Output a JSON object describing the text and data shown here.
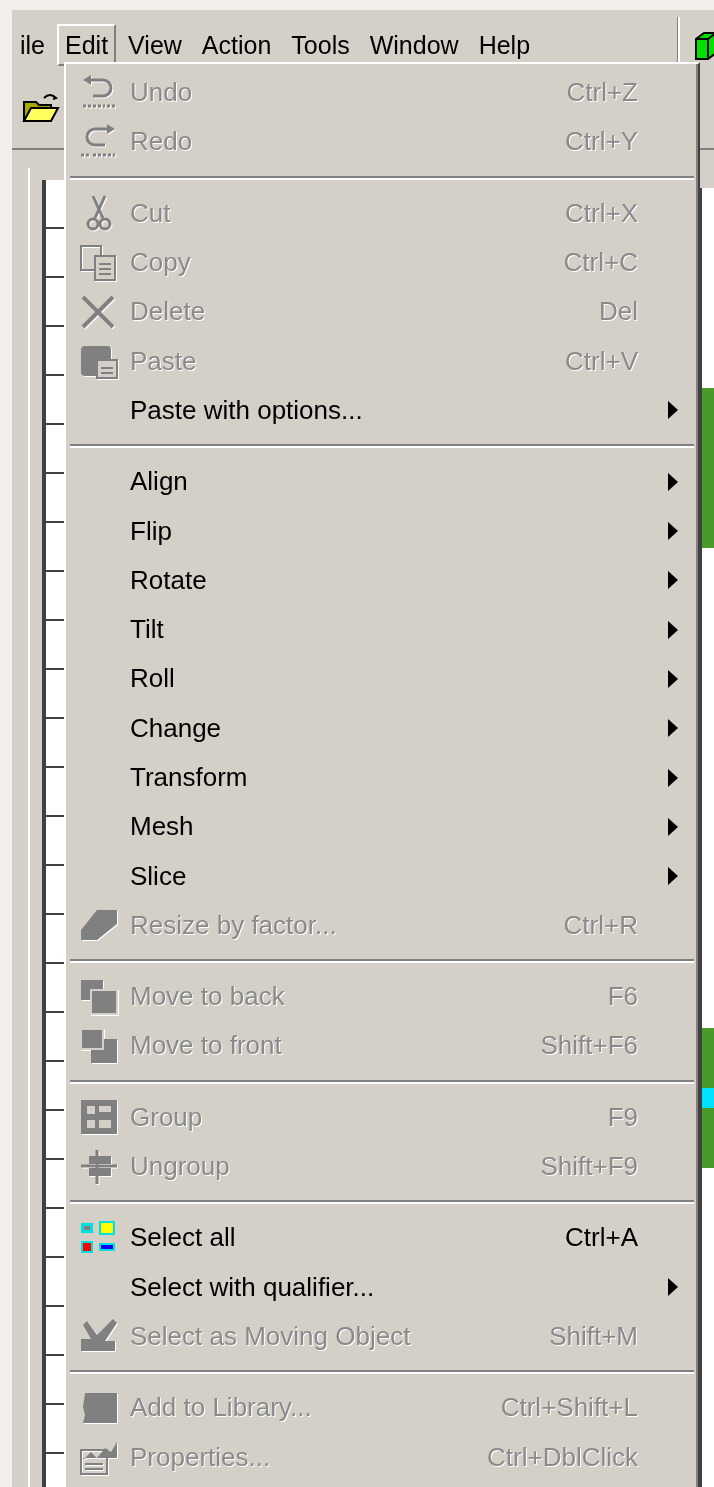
{
  "menu_bar": {
    "items": [
      {
        "label": "ile",
        "selected": false
      },
      {
        "label": "Edit",
        "selected": true
      },
      {
        "label": "View",
        "selected": false
      },
      {
        "label": "Action",
        "selected": false
      },
      {
        "label": "Tools",
        "selected": false
      },
      {
        "label": "Window",
        "selected": false
      },
      {
        "label": "Help",
        "selected": false
      }
    ]
  },
  "menu": {
    "groups": [
      {
        "items": [
          {
            "kind": "undo",
            "label": "Undo",
            "shortcut": "Ctrl+Z",
            "disabled": true,
            "submenu": false
          },
          {
            "kind": "redo",
            "label": "Redo",
            "shortcut": "Ctrl+Y",
            "disabled": true,
            "submenu": false
          }
        ]
      },
      {
        "items": [
          {
            "kind": "cut",
            "label": "Cut",
            "shortcut": "Ctrl+X",
            "disabled": true,
            "submenu": false
          },
          {
            "kind": "copy",
            "label": "Copy",
            "shortcut": "Ctrl+C",
            "disabled": true,
            "submenu": false
          },
          {
            "kind": "delete",
            "label": "Delete",
            "shortcut": "Del",
            "disabled": true,
            "submenu": false
          },
          {
            "kind": "paste",
            "label": "Paste",
            "shortcut": "Ctrl+V",
            "disabled": true,
            "submenu": false
          },
          {
            "kind": "plain",
            "label": "Paste with options...",
            "disabled": false,
            "submenu": true
          }
        ]
      },
      {
        "items": [
          {
            "kind": "plain",
            "label": "Align",
            "disabled": false,
            "submenu": true
          },
          {
            "kind": "plain",
            "label": "Flip",
            "disabled": false,
            "submenu": true
          },
          {
            "kind": "plain",
            "label": "Rotate",
            "disabled": false,
            "submenu": true
          },
          {
            "kind": "plain",
            "label": "Tilt",
            "disabled": false,
            "submenu": true
          },
          {
            "kind": "plain",
            "label": "Roll",
            "disabled": false,
            "submenu": true
          },
          {
            "kind": "plain",
            "label": "Change",
            "disabled": false,
            "submenu": true
          },
          {
            "kind": "plain",
            "label": "Transform",
            "disabled": false,
            "submenu": true
          },
          {
            "kind": "plain",
            "label": "Mesh",
            "disabled": false,
            "submenu": true
          },
          {
            "kind": "plain",
            "label": "Slice",
            "disabled": false,
            "submenu": true
          },
          {
            "kind": "resize",
            "label": "Resize by factor...",
            "shortcut": "Ctrl+R",
            "disabled": true,
            "submenu": false
          }
        ]
      },
      {
        "items": [
          {
            "kind": "move_back",
            "label": "Move to back",
            "shortcut": "F6",
            "disabled": true,
            "submenu": false
          },
          {
            "kind": "move_front",
            "label": "Move to front",
            "shortcut": "Shift+F6",
            "disabled": true,
            "submenu": false
          }
        ]
      },
      {
        "items": [
          {
            "kind": "group",
            "label": "Group",
            "shortcut": "F9",
            "disabled": true,
            "submenu": false
          },
          {
            "kind": "ungroup",
            "label": "Ungroup",
            "shortcut": "Shift+F9",
            "disabled": true,
            "submenu": false
          }
        ]
      },
      {
        "items": [
          {
            "kind": "select_all",
            "label": "Select all",
            "shortcut": "Ctrl+A",
            "disabled": false,
            "submenu": false
          },
          {
            "kind": "plain",
            "label": "Select with qualifier...",
            "disabled": false,
            "submenu": true
          },
          {
            "kind": "moving",
            "label": "Select as Moving Object",
            "shortcut": "Shift+M",
            "disabled": true,
            "submenu": false
          }
        ]
      },
      {
        "items": [
          {
            "kind": "library",
            "label": "Add to Library...",
            "shortcut": "Ctrl+Shift+L",
            "disabled": true,
            "submenu": false
          },
          {
            "kind": "properties",
            "label": "Properties...",
            "shortcut": "Ctrl+DblClick",
            "disabled": true,
            "submenu": false
          }
        ]
      }
    ]
  }
}
